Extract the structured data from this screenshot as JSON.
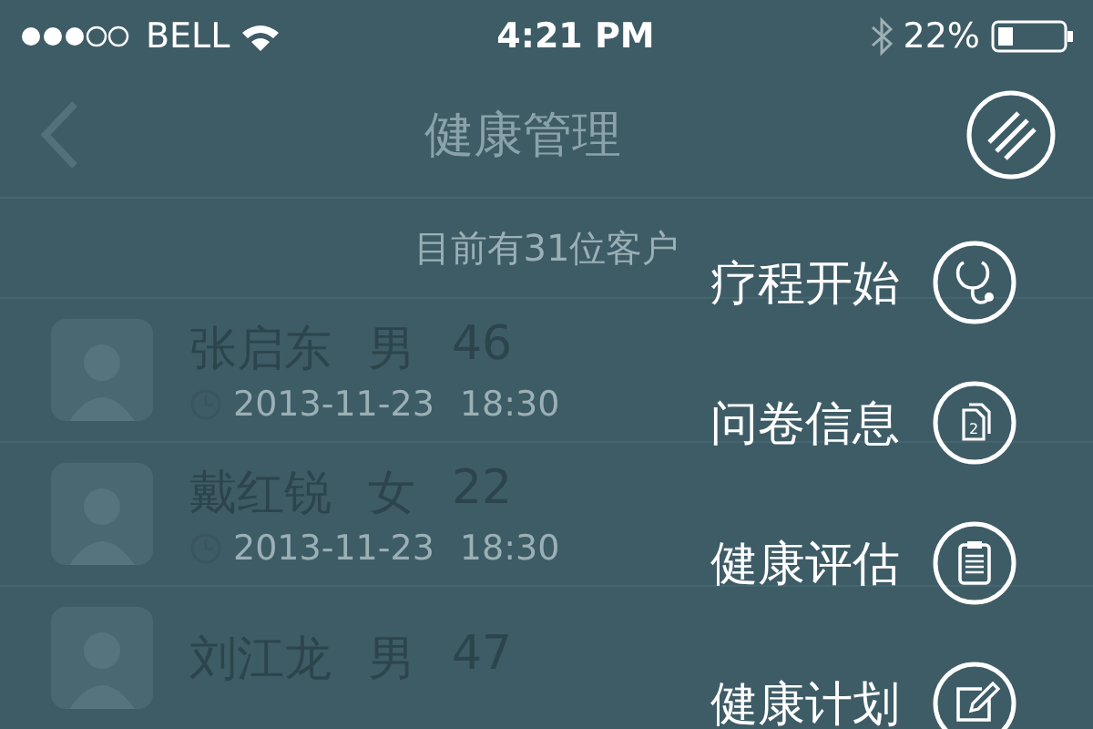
{
  "status_bar": {
    "carrier": "BELL",
    "time": "4:21 PM",
    "battery": "22%"
  },
  "nav": {
    "title": "健康管理"
  },
  "summary": "目前有31位客户",
  "customers": [
    {
      "name": "张启东",
      "gender": "男",
      "age": "46",
      "date": "2013-11-23",
      "time": "18:30"
    },
    {
      "name": "戴红锐",
      "gender": "女",
      "age": "22",
      "date": "2013-11-23",
      "time": "18:30"
    },
    {
      "name": "刘江龙",
      "gender": "男",
      "age": "47"
    }
  ],
  "menu": [
    {
      "label": "疗程开始",
      "kind": "stethoscope"
    },
    {
      "label": "问卷信息",
      "kind": "documents",
      "icon_text": "2"
    },
    {
      "label": "健康评估",
      "kind": "clipboard"
    },
    {
      "label": "健康计划",
      "kind": "edit"
    }
  ]
}
